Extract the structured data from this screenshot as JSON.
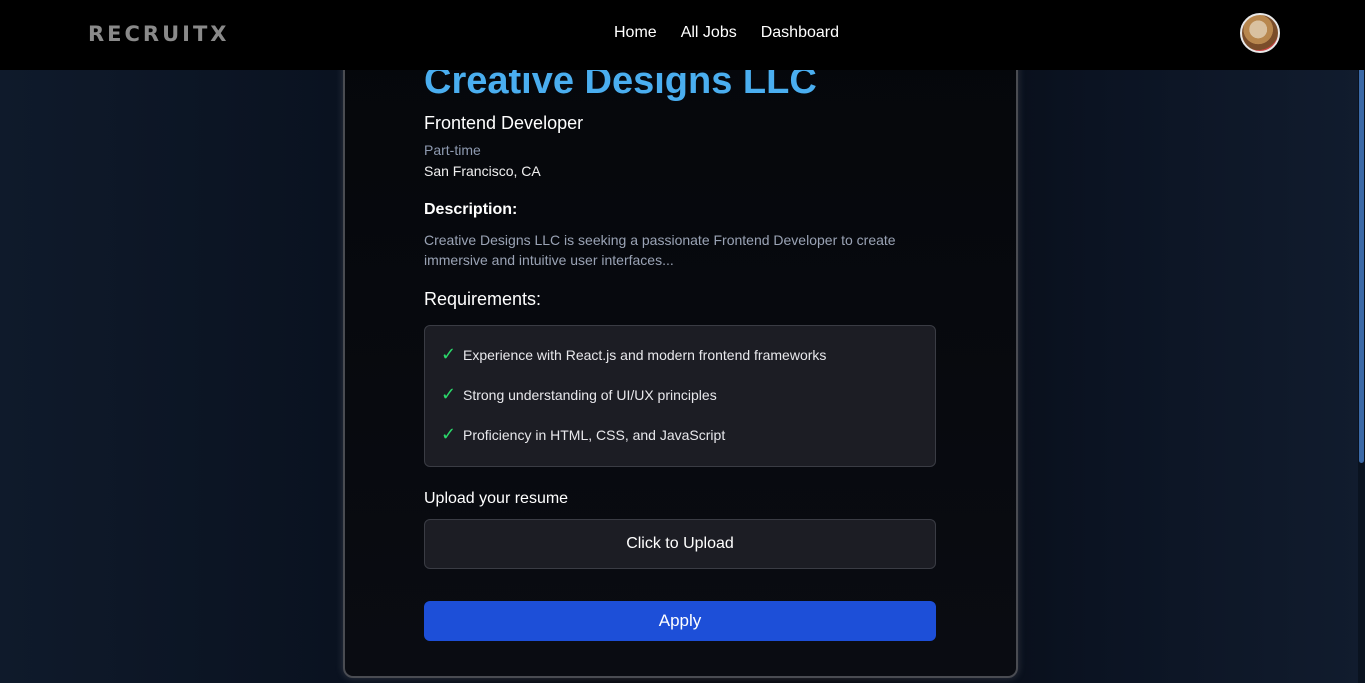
{
  "nav": {
    "logo": "RECRUITX",
    "links": [
      "Home",
      "All Jobs",
      "Dashboard"
    ],
    "avatar_icon": "user-avatar"
  },
  "job": {
    "company": "Creative Designs LLC",
    "title": "Frontend Developer",
    "type": "Part-time",
    "location": "San Francisco, CA",
    "description_heading": "Description:",
    "description": "Creative Designs LLC is seeking a passionate Frontend Developer to create immersive and intuitive user interfaces...",
    "requirements_heading": "Requirements:",
    "requirements": [
      "Experience with React.js and modern frontend frameworks",
      "Strong understanding of UI/UX principles",
      "Proficiency in HTML, CSS, and JavaScript"
    ],
    "check_symbol": "✓"
  },
  "upload": {
    "label": "Upload your resume",
    "button": "Click to Upload"
  },
  "apply": {
    "button": "Apply"
  },
  "colors": {
    "accent": "#4aaef0",
    "primary_button": "#1d4fd8",
    "check": "#2bd86a"
  }
}
